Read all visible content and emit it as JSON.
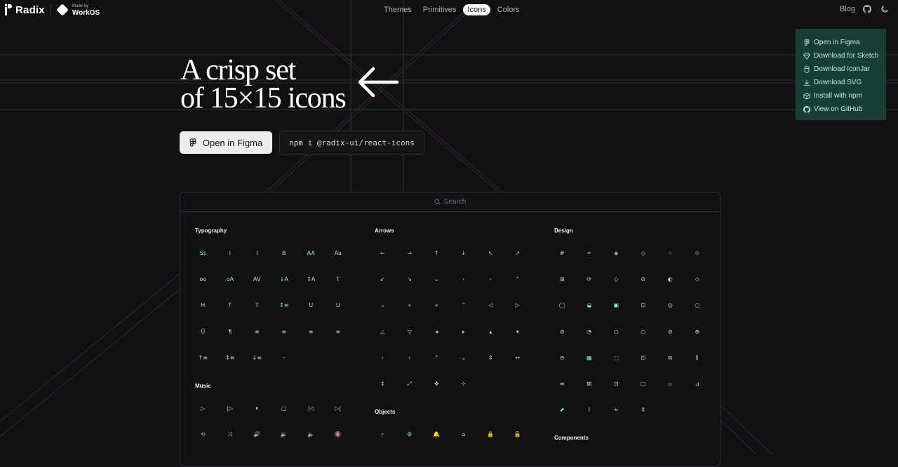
{
  "header": {
    "logo_text": "Radix",
    "workos_small": "Made by",
    "workos_big": "WorkOS",
    "nav": [
      {
        "label": "Themes",
        "active": false
      },
      {
        "label": "Primitives",
        "active": false
      },
      {
        "label": "Icons",
        "active": true
      },
      {
        "label": "Colors",
        "active": false
      }
    ],
    "blog_label": "Blog",
    "icons": [
      "github-icon",
      "theme-toggle-icon"
    ]
  },
  "hero": {
    "title_line1": "A crisp set",
    "title_line2": "of 15×15 icons",
    "figma_button": "Open in Figma",
    "npm_command": "npm i @radix-ui/react-icons"
  },
  "menu": {
    "items": [
      {
        "label": "Open in Figma",
        "icon": "figma-icon"
      },
      {
        "label": "Download for Sketch",
        "icon": "sketch-icon"
      },
      {
        "label": "Download IconJar",
        "icon": "iconjar-icon"
      },
      {
        "label": "Download SVG",
        "icon": "download-icon"
      },
      {
        "label": "Install with npm",
        "icon": "package-icon"
      },
      {
        "label": "View on GitHub",
        "icon": "github-icon"
      }
    ]
  },
  "search": {
    "placeholder": "Search"
  },
  "colors": {
    "background": "#111113",
    "icon": "#9ce2cd",
    "menu_bg": "#1a3d35",
    "border": "#2e2e33"
  },
  "categories": {
    "typography": {
      "title": "Typography",
      "icons": [
        "Ss",
        "I",
        "I",
        "B",
        "AA",
        "Aa",
        "oo",
        "oA",
        "AV",
        "↓A",
        "↕A",
        "T",
        "H",
        "T",
        "T",
        "↕≡",
        "U",
        "U",
        "Ū",
        "¶",
        "≡",
        "≡",
        "≡",
        "≡",
        "↑≡",
        "↕≡",
        "↓≡",
        "–"
      ]
    },
    "music": {
      "title": "Music",
      "icons": [
        "▷",
        "|▷",
        "⏸",
        "□",
        "|◁",
        "▷|",
        "⟲",
        "⤨",
        "🔊",
        "🔉",
        "🔈",
        "🔇"
      ]
    },
    "arrows": {
      "title": "Arrows",
      "icons": [
        "←",
        "→",
        "↑",
        "↓",
        "↖",
        "↗",
        "↙",
        "↘",
        "⌄",
        "‹",
        "›",
        "⌃",
        "⌄",
        "«",
        "»",
        "⌃",
        "◁",
        "▷",
        "△",
        "▽",
        "◂",
        "▸",
        "▴",
        "▾",
        "‹",
        "›",
        "⌃",
        "⌄",
        "⇕",
        "↔",
        "↕",
        "⤢",
        "✥",
        "⊹"
      ]
    },
    "objects": {
      "title": "Objects",
      "icons": [
        "⌕",
        "⚙",
        "🔔",
        "⌂",
        "🔒",
        "🔓"
      ]
    },
    "design": {
      "title": "Design",
      "icons": [
        "#",
        "⌗",
        "◈",
        "◇",
        "⁘",
        "⟐",
        "⊞",
        "⟳",
        "◇",
        "⊘",
        "◐",
        "◇",
        "◯",
        "◒",
        "▣",
        "⊡",
        "◎",
        "○",
        "⊘",
        "◔",
        "○",
        "○",
        "⊘",
        "⊕",
        "⊖",
        "▦",
        "⬚",
        "⊡",
        "⧉",
        "⫼",
        "≡",
        "⊠",
        "⊡",
        "□",
        "▫",
        "⊿",
        "⬈",
        "I",
        "⟛",
        "⇕"
      ]
    },
    "components": {
      "title": "Components"
    }
  }
}
